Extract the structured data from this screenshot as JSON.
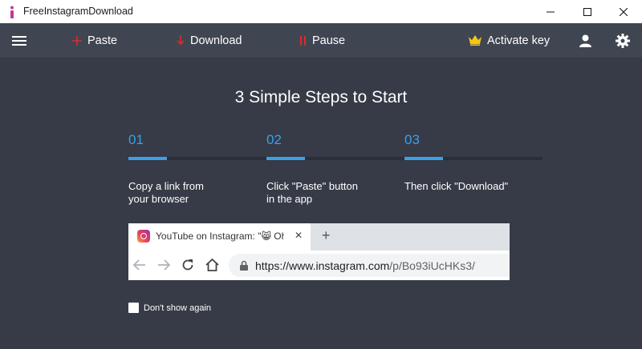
{
  "window": {
    "title": "FreeInstagramDownload",
    "icons": {
      "app": "app-logo-icon",
      "minimize": "minimize-icon",
      "maximize": "maximize-icon",
      "close": "close-icon"
    }
  },
  "toolbar": {
    "menu_icon": "hamburger-menu-icon",
    "paste_label": "Paste",
    "download_label": "Download",
    "pause_label": "Pause",
    "activate_label": "Activate key",
    "user_icon": "user-icon",
    "settings_icon": "gear-icon",
    "colors": {
      "paste": "#e02a2a",
      "download": "#e02a2a",
      "pause": "#e02a2a",
      "crown": "#f5c518"
    }
  },
  "main": {
    "heading": "3 Simple Steps to Start",
    "steps": [
      {
        "number": "01",
        "text": "Copy a link from\nyour browser",
        "progress": 0.28
      },
      {
        "number": "02",
        "text": "Click \"Paste\" button\nin the app",
        "progress": 0.28
      },
      {
        "number": "03",
        "text": "Then click \"Download\"",
        "progress": 0.28
      }
    ],
    "accent_color": "#3aa0e8"
  },
  "browser_example": {
    "tab_title": "YouTube on Instagram: \"😸 Oh. M",
    "tab_close": "✕",
    "new_tab": "+",
    "url_main": "https://www.instagram.com",
    "url_path": "/p/Bo93iUcHKs3/"
  },
  "footer": {
    "dont_show_label": "Don't show again",
    "dont_show_checked": false
  }
}
